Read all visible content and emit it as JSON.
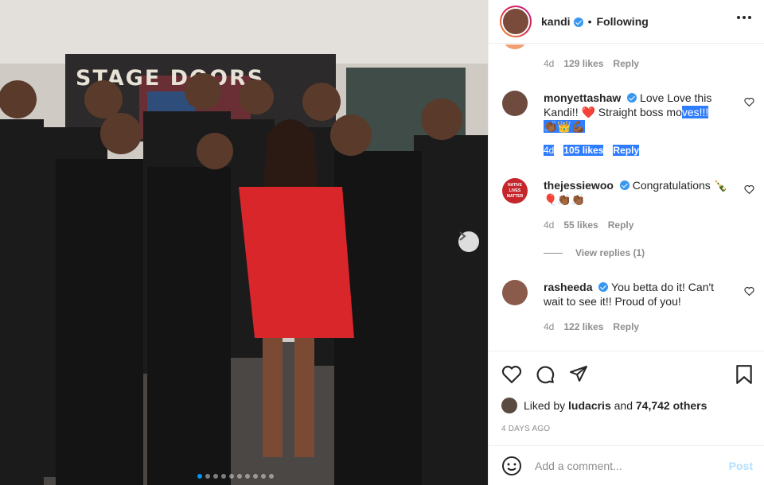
{
  "header": {
    "username": "kandi",
    "separator": "•",
    "follow_status": "Following"
  },
  "comments": {
    "top_meta": {
      "time": "4d",
      "likes": "129 likes",
      "reply": "Reply"
    },
    "items": [
      {
        "username": "monyettashaw",
        "text_plain": "Love Love this Kandi!! ",
        "text_heart": "❤️",
        "text_after": " Straight boss mo",
        "text_selected": "ves!!!",
        "emojis": "👏🏾👑💪🏾",
        "time": "4d",
        "likes": "105 likes",
        "reply": "Reply"
      },
      {
        "username": "thejessiewoo",
        "avatar_text": "NATIVE LIVES MATTER",
        "text_plain": "Congratulations 🍾",
        "emojis": "🎈👏🏾👏🏾",
        "time": "4d",
        "likes": "55 likes",
        "reply": "Reply",
        "view_replies": "View replies (1)"
      },
      {
        "username": "rasheeda",
        "text_plain": "You betta do it! Can't wait to see it!! Proud of you!",
        "time": "4d",
        "likes": "122 likes",
        "reply": "Reply"
      }
    ]
  },
  "liked_by": {
    "prefix": "Liked by ",
    "user": "ludacris",
    "middle": " and ",
    "count": "74,742 others"
  },
  "timestamp": "4 DAYS AGO",
  "add_comment": {
    "placeholder": "Add a comment...",
    "post": "Post"
  },
  "photo": {
    "sign_text": "STAGE DOORS",
    "slide_count": 10,
    "active_slide": 0
  },
  "colors": {
    "accent": "#0095f6",
    "verified": "#3897f0",
    "red_dress": "#d8262b",
    "post_disabled": "#b2dffc"
  }
}
